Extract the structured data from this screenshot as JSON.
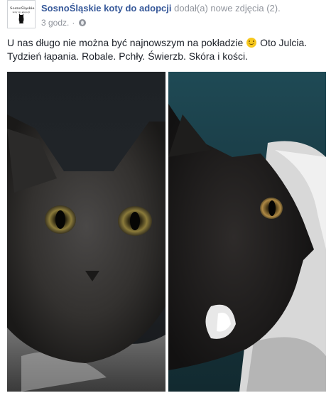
{
  "post": {
    "page_name": "SosnoŚląskie koty do adopcji",
    "action": " dodał(a) nowe zdjęcia (2).",
    "time": "3 godz.",
    "separator": "·",
    "visibility_icon": "globe-icon",
    "text_line1": "U nas długo nie można być najnowszym na pokładzie",
    "text_line1_end": " Oto Julcia.",
    "text_line2": "Tydzień łapania. Robale. Pchły. Świerzb. Skóra i kości.",
    "emoji": "smile-emoji"
  },
  "avatar": {
    "logo_text": "SosnoŚląskie",
    "logo_subtext": "koty do adopcji"
  },
  "photos": [
    {
      "name": "photo-cat-front"
    },
    {
      "name": "photo-cat-profile"
    }
  ],
  "colors": {
    "link": "#365899",
    "meta": "#90949c",
    "text": "#1d2129"
  }
}
